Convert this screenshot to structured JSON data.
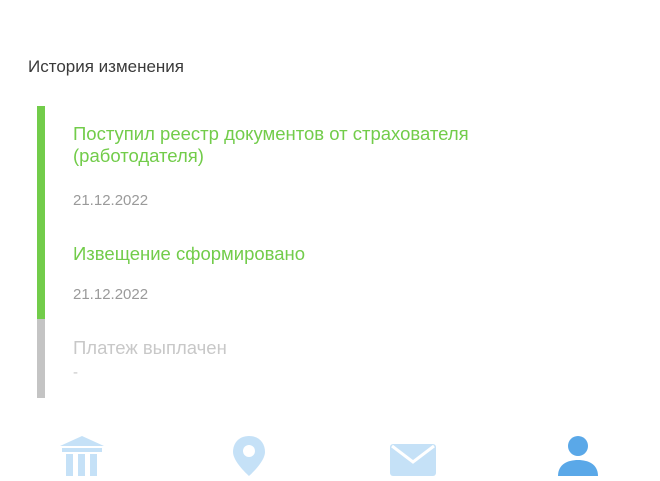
{
  "history": {
    "title": "История изменения",
    "entries": [
      {
        "title": "Поступил реестр документов от страхователя (работодателя)",
        "date": "21.12.2022",
        "status": "done"
      },
      {
        "title": "Извещение сформировано",
        "date": "21.12.2022",
        "status": "done"
      },
      {
        "title": "Платеж выплачен",
        "date": "-",
        "status": "pending"
      }
    ]
  },
  "nav": {
    "items": [
      {
        "icon": "bank-icon"
      },
      {
        "icon": "location-pin-icon"
      },
      {
        "icon": "mail-icon"
      },
      {
        "icon": "profile-icon"
      }
    ]
  },
  "colors": {
    "accent": "#72cc4a",
    "pending": "#c4c4c4",
    "nav_icon": "#5aa8e8"
  }
}
